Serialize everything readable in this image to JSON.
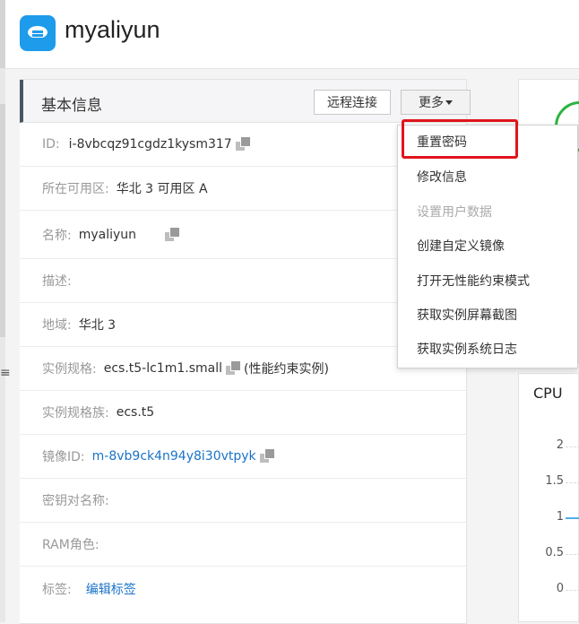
{
  "header": {
    "title": "myaliyun",
    "logo_icon": "cloud-server-icon",
    "brand_color": "#1e9bea"
  },
  "info_panel": {
    "title": "基本信息",
    "remote_button": "远程连接",
    "more_button": "更多",
    "rows": [
      {
        "label": "ID:",
        "value": "i-8vbcqz91cgdz1kysm317",
        "copy": true
      },
      {
        "label": "所在可用区:",
        "value": "华北 3 可用区 A"
      },
      {
        "label": "名称:",
        "value": "myaliyun",
        "copy": true
      },
      {
        "label": "描述:",
        "value": ""
      },
      {
        "label": "地域:",
        "value": "华北 3"
      },
      {
        "label": "实例规格:",
        "value": "ecs.t5-lc1m1.small",
        "copy": true,
        "note": "(性能约束实例)"
      },
      {
        "label": "实例规格族:",
        "value": "ecs.t5"
      },
      {
        "label": "镜像ID:",
        "value": "m-8vb9ck4n94y8i30vtpyk",
        "copy": true,
        "link": true
      },
      {
        "label": "密钥对名称:",
        "value": ""
      },
      {
        "label": "RAM角色:",
        "value": ""
      },
      {
        "label": "标签:",
        "value": "编辑标签",
        "link": true
      }
    ]
  },
  "dropdown": {
    "items": [
      {
        "label": "重置密码",
        "highlighted": true
      },
      {
        "label": "修改信息"
      },
      {
        "label": "设置用户数据",
        "disabled": true
      },
      {
        "label": "创建自定义镜像"
      },
      {
        "label": "打开无性能约束模式"
      },
      {
        "label": "获取实例屏幕截图"
      },
      {
        "label": "获取实例系统日志"
      }
    ],
    "highlight_color": "#e1141c"
  },
  "cpu_card": {
    "title": "CPU",
    "y_ticks": [
      "2",
      "1.5",
      "1",
      "0.5",
      "0"
    ],
    "line_color": "#4fb0e8"
  },
  "status_color": "#2db342"
}
